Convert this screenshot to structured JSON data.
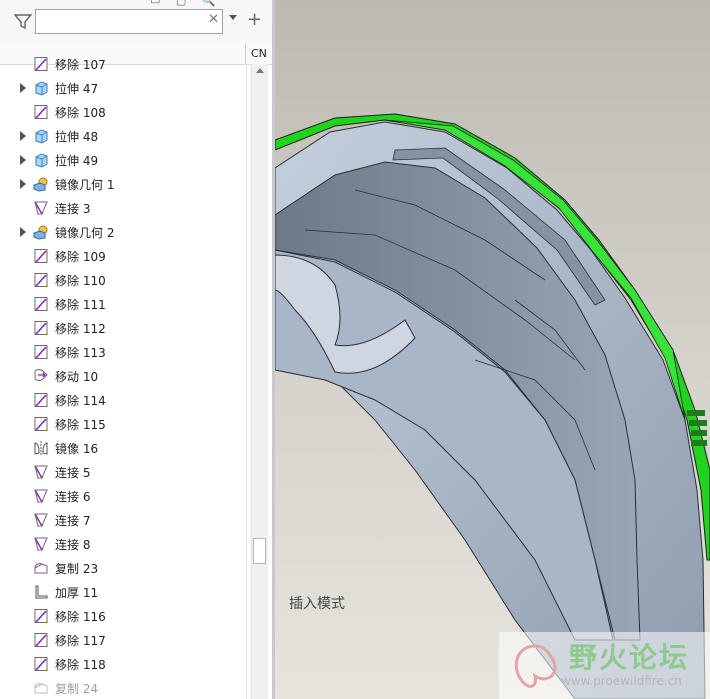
{
  "model_tree": {
    "column_header": "CN",
    "search": {
      "value": "",
      "placeholder": ""
    },
    "items": [
      {
        "label": "移除 107",
        "icon": "remove-feature-icon",
        "expandable": false
      },
      {
        "label": "拉伸 47",
        "icon": "extrude-icon",
        "expandable": true
      },
      {
        "label": "移除 108",
        "icon": "remove-feature-icon",
        "expandable": false
      },
      {
        "label": "拉伸 48",
        "icon": "extrude-icon",
        "expandable": true
      },
      {
        "label": "拉伸 49",
        "icon": "extrude-icon",
        "expandable": true
      },
      {
        "label": "镜像几何 1",
        "icon": "mirror-geometry-icon",
        "expandable": true
      },
      {
        "label": "连接 3",
        "icon": "connect-icon",
        "expandable": false
      },
      {
        "label": "镜像几何 2",
        "icon": "mirror-geometry-icon",
        "expandable": true
      },
      {
        "label": "移除 109",
        "icon": "remove-feature-icon",
        "expandable": false
      },
      {
        "label": "移除 110",
        "icon": "remove-feature-icon",
        "expandable": false
      },
      {
        "label": "移除 111",
        "icon": "remove-feature-icon",
        "expandable": false
      },
      {
        "label": "移除 112",
        "icon": "remove-feature-icon",
        "expandable": false
      },
      {
        "label": "移除 113",
        "icon": "remove-feature-icon",
        "expandable": false
      },
      {
        "label": "移动 10",
        "icon": "move-icon",
        "expandable": false
      },
      {
        "label": "移除 114",
        "icon": "remove-feature-icon",
        "expandable": false
      },
      {
        "label": "移除 115",
        "icon": "remove-feature-icon",
        "expandable": false
      },
      {
        "label": "镜像 16",
        "icon": "mirror-icon",
        "expandable": false
      },
      {
        "label": "连接 5",
        "icon": "connect-icon",
        "expandable": false
      },
      {
        "label": "连接 6",
        "icon": "connect-icon",
        "expandable": false
      },
      {
        "label": "连接 7",
        "icon": "connect-icon",
        "expandable": false
      },
      {
        "label": "连接 8",
        "icon": "connect-icon",
        "expandable": false
      },
      {
        "label": "复制 23",
        "icon": "copy-icon",
        "expandable": false
      },
      {
        "label": "加厚 11",
        "icon": "thicken-icon",
        "expandable": false
      },
      {
        "label": "移除 116",
        "icon": "remove-feature-icon",
        "expandable": false
      },
      {
        "label": "移除 117",
        "icon": "remove-feature-icon",
        "expandable": false
      },
      {
        "label": "移除 118",
        "icon": "remove-feature-icon",
        "expandable": false
      },
      {
        "label": "复制 24",
        "icon": "copy-icon",
        "expandable": false,
        "dimmed": true
      }
    ]
  },
  "viewport": {
    "mode_label": "插入模式",
    "highlight_color": "#1fd31f",
    "body_color": "#a9b6c7"
  },
  "watermark": {
    "title": "野火论坛",
    "url": "www.proewildfire.cn"
  }
}
